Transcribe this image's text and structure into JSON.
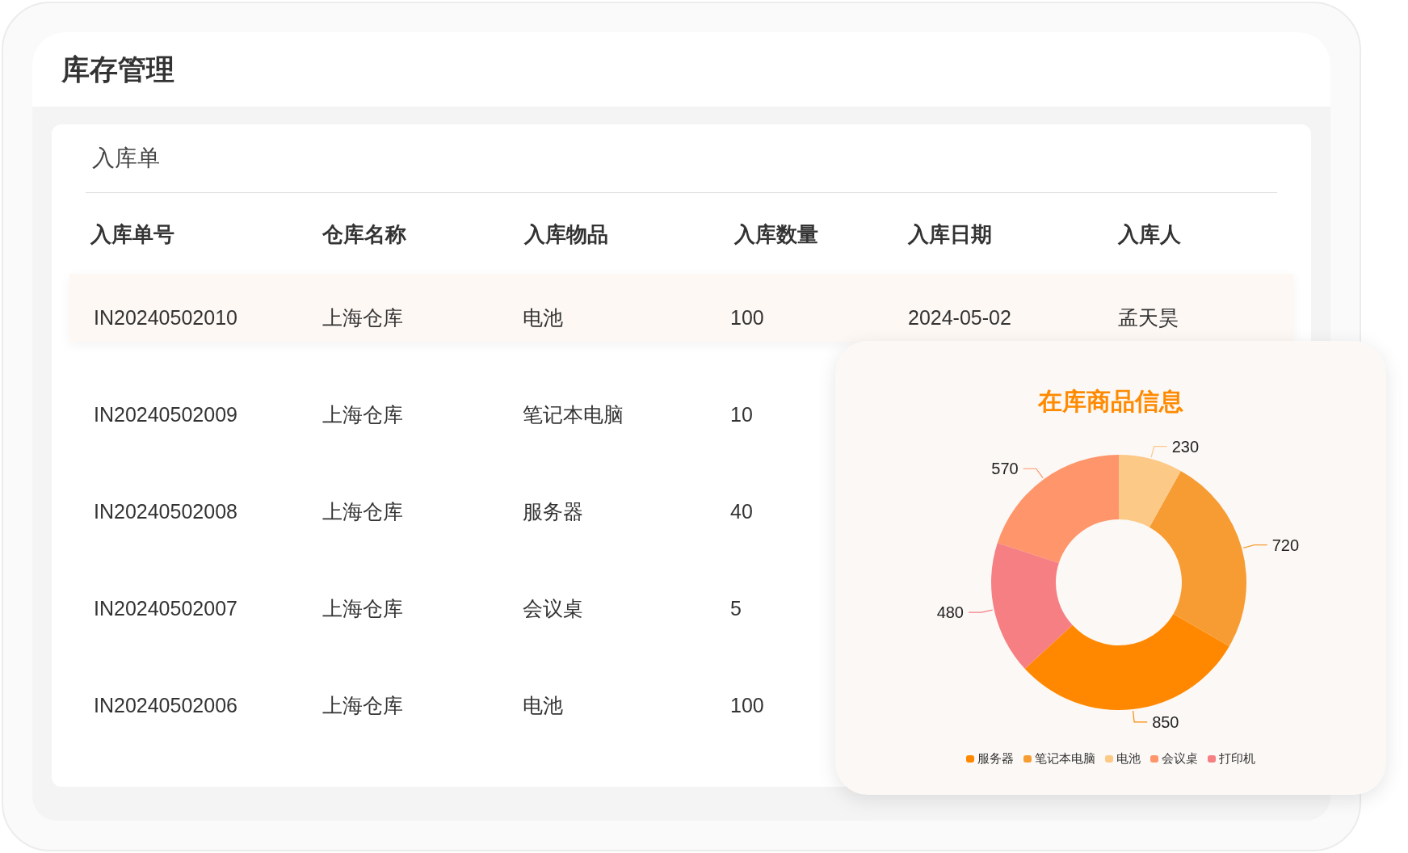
{
  "header": {
    "title": "库存管理"
  },
  "card": {
    "title": "入库单"
  },
  "table": {
    "columns": [
      "入库单号",
      "仓库名称",
      "入库物品",
      "入库数量",
      "入库日期",
      "入库人"
    ],
    "rows": [
      {
        "selected": true,
        "cells": [
          "IN20240502010",
          "上海仓库",
          "电池",
          "100",
          "2024-05-02",
          "孟天昊"
        ]
      },
      {
        "selected": false,
        "cells": [
          "IN20240502009",
          "上海仓库",
          "笔记本电脑",
          "10"
        ]
      },
      {
        "selected": false,
        "cells": [
          "IN20240502008",
          "上海仓库",
          "服务器",
          "40"
        ]
      },
      {
        "selected": false,
        "cells": [
          "IN20240502007",
          "上海仓库",
          "会议桌",
          "5"
        ]
      },
      {
        "selected": false,
        "cells": [
          "IN20240502006",
          "上海仓库",
          "电池",
          "100"
        ]
      }
    ]
  },
  "chart_panel": {
    "chart_data": {
      "type": "donut",
      "title": "在库商品信息",
      "categories": [
        "服务器",
        "笔记本电脑",
        "电池",
        "会议桌",
        "打印机"
      ],
      "series": [
        {
          "colors": [
            "#ff8800",
            "#f79c33",
            "#fdc987",
            "#fe956b",
            "#f67f83"
          ],
          "values": [
            850,
            720,
            230,
            570,
            480
          ]
        }
      ],
      "data_labels": true
    }
  }
}
